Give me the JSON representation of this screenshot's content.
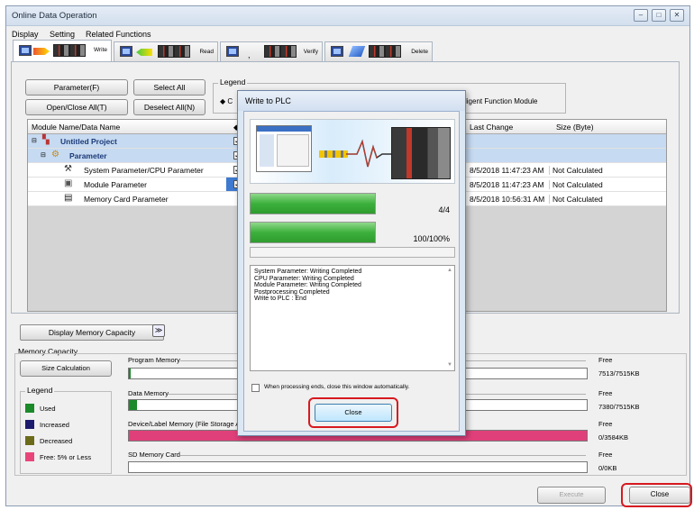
{
  "window": {
    "title": "Online Data Operation",
    "controls": [
      "minimize-icon",
      "maximize-icon",
      "close-icon"
    ]
  },
  "menu": [
    "Display",
    "Setting",
    "Related Functions"
  ],
  "tabs": [
    {
      "label": "Write",
      "active": true
    },
    {
      "label": "Read",
      "active": false
    },
    {
      "label": "Verify",
      "active": false
    },
    {
      "label": "Delete",
      "active": false
    }
  ],
  "toolbar": {
    "parameter": "Parameter(F)",
    "select_all": "Select All",
    "open_close_all": "Open/Close All(T)",
    "deselect_all": "Deselect All(N)",
    "legend_title": "Legend",
    "legend_text": "ligent Function Module"
  },
  "grid": {
    "headers": {
      "name": "Module Name/Data Name",
      "last_change": "Last Change",
      "size": "Size (Byte)"
    },
    "rows": [
      {
        "name": "Untitled Project",
        "bold": true,
        "last_change": "",
        "size": ""
      },
      {
        "name": "Parameter",
        "bold": true,
        "last_change": "",
        "size": ""
      },
      {
        "name": "System Parameter/CPU Parameter",
        "last_change": "8/5/2018 11:47:23 AM",
        "size": "Not Calculated"
      },
      {
        "name": "Module Parameter",
        "last_change": "8/5/2018 11:47:23 AM",
        "size": "Not Calculated"
      },
      {
        "name": "Memory Card Parameter",
        "last_change": "8/5/2018 10:56:31 AM",
        "size": "Not Calculated"
      }
    ]
  },
  "memory": {
    "display_button": "Display Memory Capacity",
    "capacity_label": "Memory Capacity",
    "size_calc_button": "Size Calculation",
    "legend_title": "Legend",
    "legend": [
      {
        "label": "Used",
        "color": "#1a8a2a"
      },
      {
        "label": "Increased",
        "color": "#1c1c6e"
      },
      {
        "label": "Decreased",
        "color": "#6b6b1a"
      },
      {
        "label": "Free: 5% or Less",
        "color": "#e8467a"
      }
    ],
    "bars": [
      {
        "name": "Program Memory",
        "free_label": "Free",
        "free": "7513/7515KB",
        "used_fraction": 0.003
      },
      {
        "name": "Data Memory",
        "free_label": "Free",
        "free": "7380/7515KB",
        "used_fraction": 0.018
      },
      {
        "name": "Device/Label Memory (File Storage Ar",
        "free_label": "Free",
        "free": "0/3584KB",
        "used_fraction": 1.0
      },
      {
        "name": "SD Memory Card",
        "free_label": "Free",
        "free": "0/0KB",
        "used_fraction": 0
      }
    ]
  },
  "footer": {
    "execute": "Execute",
    "close": "Close"
  },
  "dialog": {
    "title": "Write to PLC",
    "progress1": {
      "text": "4/4",
      "fraction": 1.0
    },
    "progress2": {
      "text": "100/100%",
      "fraction": 1.0
    },
    "log": [
      "System Parameter: Writing Completed",
      "CPU Parameter: Writing Completed",
      "Module Parameter: Writing Completed",
      "Postprocessing Completed",
      "Write to PLC : End"
    ],
    "auto_close_label": "When processing ends, close this window automatically.",
    "close_button": "Close"
  }
}
